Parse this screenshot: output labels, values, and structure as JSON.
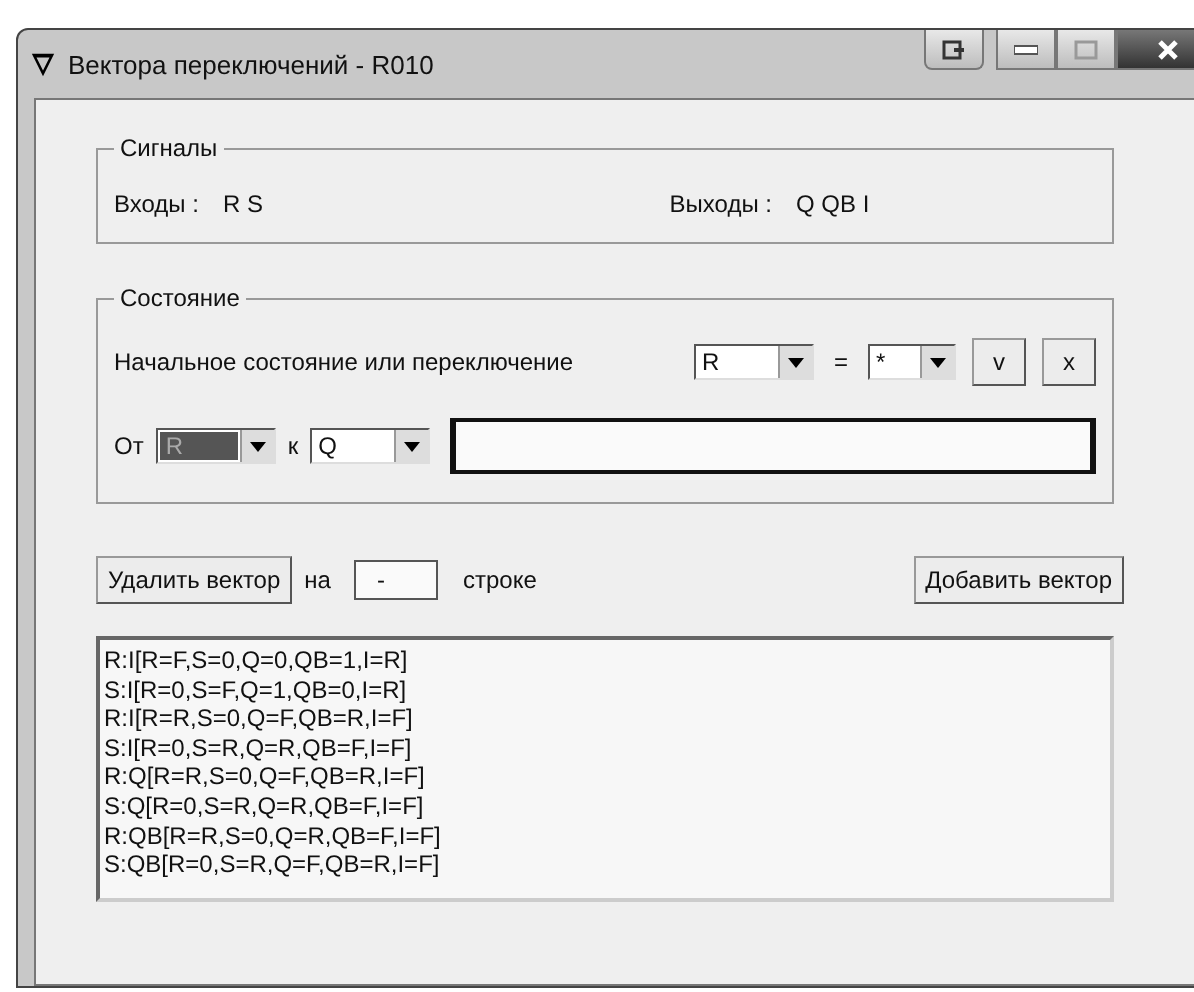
{
  "window": {
    "title": "Вектора переключений - R010"
  },
  "signals": {
    "title": "Сигналы",
    "inputs_label": "Входы :",
    "inputs": "R S",
    "outputs_label": "Выходы :",
    "outputs": "Q QB I"
  },
  "state": {
    "title": "Состояние",
    "initial_label": "Начальное состояние или переключение",
    "signal_combo": {
      "value": "R",
      "highlighted": false
    },
    "equals": "=",
    "value_combo": {
      "value": "*",
      "highlighted": false
    },
    "ok_button": "v",
    "cancel_button": "x",
    "from_label": "От",
    "from_combo": {
      "value": "R",
      "highlighted": true
    },
    "to_label": "к",
    "to_combo": {
      "value": "Q",
      "highlighted": false
    }
  },
  "delete_button": "Удалить вектор",
  "at_label": "на",
  "row_field": {
    "value": "-"
  },
  "row_label": "строке",
  "add_button": "Добавить вектор",
  "vectors": [
    "R:I[R=F,S=0,Q=0,QB=1,I=R]",
    "S:I[R=0,S=F,Q=1,QB=0,I=R]",
    "R:I[R=R,S=0,Q=F,QB=R,I=F]",
    "S:I[R=0,S=R,Q=R,QB=F,I=F]",
    "R:Q[R=R,S=0,Q=F,QB=R,I=F]",
    "S:Q[R=0,S=R,Q=R,QB=F,I=F]",
    "R:QB[R=R,S=0,Q=R,QB=F,I=F]",
    "S:QB[R=0,S=R,Q=F,QB=R,I=F]"
  ]
}
